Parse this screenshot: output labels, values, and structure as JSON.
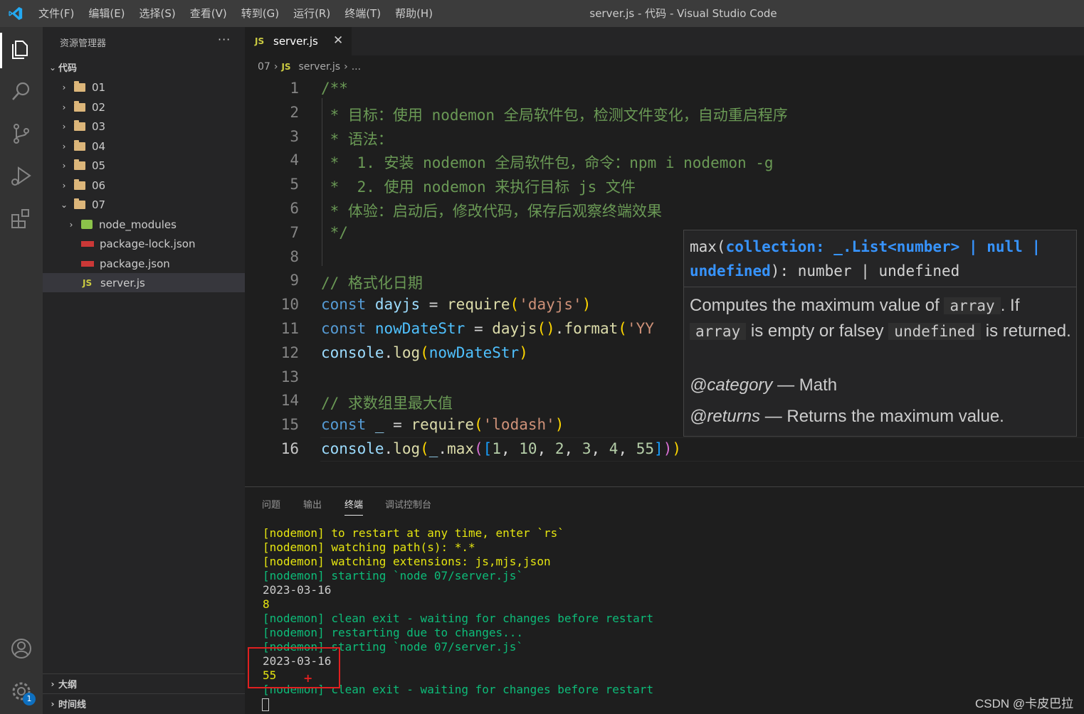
{
  "window": {
    "title": "server.js - 代码 - Visual Studio Code",
    "menu": [
      "文件(F)",
      "编辑(E)",
      "选择(S)",
      "查看(V)",
      "转到(G)",
      "运行(R)",
      "终端(T)",
      "帮助(H)"
    ]
  },
  "activity_bar": {
    "icons": [
      "explorer-icon",
      "search-icon",
      "source-control-icon",
      "run-debug-icon",
      "extensions-icon",
      "account-icon",
      "settings-gear-icon"
    ],
    "settings_badge": "1"
  },
  "sidebar": {
    "header": "资源管理器",
    "more": "···",
    "root": "代码",
    "folders": [
      "01",
      "02",
      "03",
      "04",
      "05",
      "06",
      "07"
    ],
    "children_07": [
      "node_modules",
      "package-lock.json",
      "package.json",
      "server.js"
    ],
    "selected": "server.js",
    "outline": "大纲",
    "timeline": "时间线"
  },
  "tab": {
    "icon": "JS",
    "label": "server.js",
    "close": "✕"
  },
  "breadcrumb": {
    "folder": "07",
    "icon": "JS",
    "file": "server.js",
    "more": "..."
  },
  "code": {
    "active_line": 16,
    "lines": [
      "/**",
      " * 目标：使用 nodemon 全局软件包，检测文件变化，自动重启程序",
      " * 语法：",
      " *  1. 安装 nodemon 全局软件包，命令：npm i nodemon -g",
      " *  2. 使用 nodemon 来执行目标 js 文件",
      " * 体验：启动后，修改代码，保存后观察终端效果",
      " */",
      "",
      "// 格式化日期",
      "const dayjs = require('dayjs')",
      "const nowDateStr = dayjs().format('YY",
      "console.log(nowDateStr)",
      "",
      "// 求数组里最大值",
      "const _ = require('lodash')",
      "console.log(_.max([1, 10, 2, 3, 4, 55]))"
    ]
  },
  "hover": {
    "sig_fn": "max(",
    "sig_param": "collection: _.List<number> | null | undefined",
    "sig_rest": "): number | undefined",
    "doc_1": "Computes the maximum value of",
    "doc_code_1": "array",
    "doc_2": ". If",
    "doc_code_2": "array",
    "doc_3": "is empty or falsey",
    "doc_code_3": "undefined",
    "doc_4": "is returned.",
    "category_tag": "@category",
    "category_text": "— Math",
    "returns_tag": "@returns",
    "returns_text": "— Returns the maximum value."
  },
  "panel": {
    "tabs": [
      "问题",
      "输出",
      "终端",
      "调试控制台"
    ],
    "active_tab": "终端",
    "terminal_lines": [
      {
        "text": "[nodemon] to restart at any time, enter `rs`",
        "color": "yellow"
      },
      {
        "text": "[nodemon] watching path(s): *.*",
        "color": "yellow"
      },
      {
        "text": "[nodemon] watching extensions: js,mjs,json",
        "color": "yellow"
      },
      {
        "text": "[nodemon] starting `node 07/server.js`",
        "color": "green"
      },
      {
        "text": "2023-03-16",
        "color": "white"
      },
      {
        "text": "8",
        "color": "yellow"
      },
      {
        "text": "[nodemon] clean exit - waiting for changes before restart",
        "color": "green"
      },
      {
        "text": "[nodemon] restarting due to changes...",
        "color": "green"
      },
      {
        "text": "[nodemon] starting `node 07/server.js`",
        "color": "green"
      },
      {
        "text": "2023-03-16",
        "color": "white"
      },
      {
        "text": "55",
        "color": "yellow"
      },
      {
        "text": "[nodemon] clean exit - waiting for changes before restart",
        "color": "green"
      }
    ]
  },
  "watermark": "CSDN @卡皮巴拉",
  "colors": {
    "accent": "#0e70c0",
    "comment": "#6a9955",
    "keyword": "#569cd6",
    "highlight_box": "#e02020"
  }
}
